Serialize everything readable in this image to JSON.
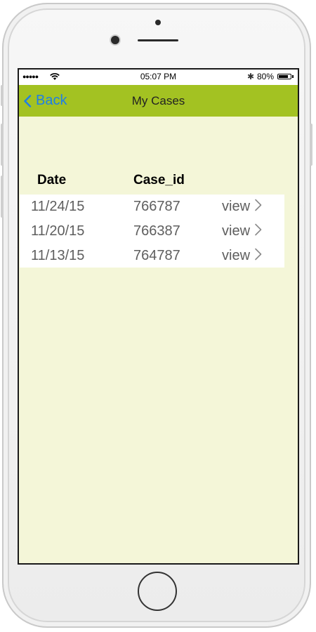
{
  "status_bar": {
    "signal": "●●●●●",
    "time": "05:07 PM",
    "bluetooth": "✱",
    "battery_percent": "80%",
    "battery_level": 0.8
  },
  "nav": {
    "back_label": "Back",
    "title": "My Cases"
  },
  "table": {
    "headers": {
      "date": "Date",
      "case_id": "Case_id"
    },
    "rows": [
      {
        "date": "11/24/15",
        "case_id": "766787",
        "action": "view"
      },
      {
        "date": "11/20/15",
        "case_id": "766387",
        "action": "view"
      },
      {
        "date": "11/13/15",
        "case_id": "764787",
        "action": "view"
      }
    ]
  },
  "colors": {
    "nav_bar": "#a3c222",
    "screen_background": "#f4f6d8",
    "back_link": "#1f7fe6",
    "row_text": "#5e5e5e"
  },
  "icons": {
    "back": "chevron-left-icon",
    "row_action": "chevron-right-icon",
    "wifi": "wifi-icon",
    "bluetooth": "bluetooth-icon",
    "battery": "battery-icon"
  }
}
